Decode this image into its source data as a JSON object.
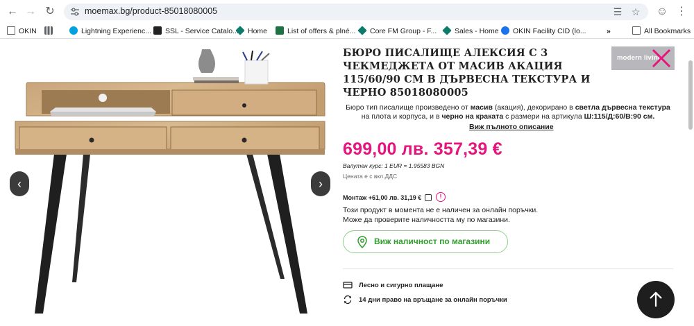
{
  "browser": {
    "url": "moemax.bg/product-85018080005",
    "bookmarks": [
      {
        "label": "OKIN",
        "color": "#5f6368"
      },
      {
        "label": "",
        "color": "#5f6368"
      },
      {
        "label": "Lightning Experienc...",
        "color": "#00a1e0"
      },
      {
        "label": "SSL - Service Catalo...",
        "color": "#222222"
      },
      {
        "label": "Home",
        "color": "#0f7b6c"
      },
      {
        "label": "List of offers & plné...",
        "color": "#1e7145"
      },
      {
        "label": "Core FM Group - F...",
        "color": "#0f7b6c"
      },
      {
        "label": "Sales - Home",
        "color": "#00a1e0"
      },
      {
        "label": "OKIN Facility CID (lo...",
        "color": "#1a73e8"
      },
      {
        "label": "All Bookmarks",
        "color": "#5f6368"
      }
    ]
  },
  "product": {
    "title": "БЮРО ПИСАЛИЩЕ АЛЕКСИЯ С 3 ЧЕКМЕДЖЕТА ОТ МАСИВ АКАЦИЯ 115/60/90 СМ В ДЪРВЕСНА ТЕКСТУРА И ЧЕРНО 85018080005",
    "brand": "modern living",
    "description": {
      "p1": "Бюро тип писалище произведено от ",
      "b1": "масив",
      "p2": " (акация), декорирано в ",
      "b2": "светла дървесна текстура",
      "p3": " на плота и корпуса, и в ",
      "b3": "черно на краката",
      "p4": " с размери на артикула ",
      "b4": "Ш:115/Д:60/В:90 см."
    },
    "full_description_link": "Виж пълното описание",
    "price": "699,00 лв. 357,39 €",
    "exchange_rate": "Валутен курс: 1 EUR = 1.95583 BGN",
    "vat_note": "Цената е с вкл.ДДС",
    "assembly_label": "Монтаж +61,00 лв. 31,19 €",
    "availability_line1": "Този продукт в момента не е наличен за онлайн поръчки.",
    "availability_line2": "Може да проверите наличността му по магазини.",
    "store_button": "Виж наличност по магазини",
    "feature_payment": "Лесно и сигурно плащане",
    "feature_return": "14 дни право на връщане за онлайн поръчки"
  },
  "colors": {
    "accent": "#e6157d",
    "green": "#2f9e2c"
  }
}
